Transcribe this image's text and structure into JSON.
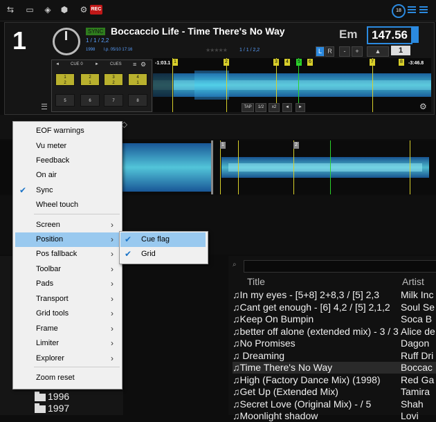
{
  "toolbar": {
    "icons": [
      "mixer-icon",
      "window-icon",
      "broadcast-icon",
      "cube-icon",
      "gear-icon"
    ],
    "rec_label": "REC",
    "clock_label": "18"
  },
  "deck": {
    "number": "1",
    "sync_label": "SYNC",
    "title": "Boccaccio Life - Time There's No Way",
    "subtitle": "1 / 1 / 2,2",
    "year": "1998",
    "last_played": "l.p. 05/10 17:16",
    "rating_count": "1 / 1 / 2,2",
    "key": "Em",
    "bpm": "147.56",
    "pitch_value": "1",
    "lr_left": "L",
    "lr_right": "R",
    "minus": "-",
    "plus": "+",
    "up_arrow": "▲"
  },
  "pads": {
    "cue_label": "CUE 0",
    "cues_label": "CUES",
    "prev": "◄",
    "next": "►",
    "row1": [
      "1\n2",
      "2\n1",
      "3\n2",
      "4\n1"
    ],
    "row2": [
      "5",
      "6",
      "7",
      "8"
    ]
  },
  "overview": {
    "time_left": "-1:03.1",
    "time_right": "-3:46.8",
    "markers": [
      "1",
      "2",
      "3",
      "4",
      "5",
      "6",
      "7",
      "8"
    ],
    "buttons": [
      "TAP",
      "1/2",
      "x2",
      "◄",
      "►"
    ]
  },
  "bigwave": {
    "markers": [
      "1",
      "2"
    ]
  },
  "menu": {
    "items": [
      {
        "label": "EOF warnings",
        "checked": false,
        "submenu": false
      },
      {
        "label": "Vu meter",
        "checked": false,
        "submenu": false
      },
      {
        "label": "Feedback",
        "checked": false,
        "submenu": false
      },
      {
        "label": "On air",
        "checked": false,
        "submenu": false
      },
      {
        "label": "Sync",
        "checked": true,
        "submenu": false
      },
      {
        "label": "Wheel touch",
        "checked": false,
        "submenu": false
      },
      {
        "label": "Screen",
        "checked": false,
        "submenu": true
      },
      {
        "label": "Position",
        "checked": false,
        "submenu": true
      },
      {
        "label": "Pos fallback",
        "checked": false,
        "submenu": true
      },
      {
        "label": "Toolbar",
        "checked": false,
        "submenu": true
      },
      {
        "label": "Pads",
        "checked": false,
        "submenu": true
      },
      {
        "label": "Transport",
        "checked": false,
        "submenu": true
      },
      {
        "label": "Grid tools",
        "checked": false,
        "submenu": true
      },
      {
        "label": "Frame",
        "checked": false,
        "submenu": true
      },
      {
        "label": "Limiter",
        "checked": false,
        "submenu": true
      },
      {
        "label": "Explorer",
        "checked": false,
        "submenu": true
      },
      {
        "label": "Zoom reset",
        "checked": false,
        "submenu": false
      }
    ]
  },
  "submenu": {
    "items": [
      {
        "label": "Cue flag",
        "checked": true
      },
      {
        "label": "Grid",
        "checked": true
      }
    ]
  },
  "folders": [
    "1996",
    "1997"
  ],
  "browser": {
    "col_title": "Title",
    "col_artist": "Artist",
    "rows": [
      {
        "title": "In my eyes - [5+8] 2+8,3 / [5] 2,3",
        "artist": "Milk Inc"
      },
      {
        "title": "Cant get enough - [6] 4,2 / [5] 2,1,2",
        "artist": "Soul Se"
      },
      {
        "title": "Keep On Bumpin",
        "artist": "Soca B"
      },
      {
        "title": "better off alone (extended mix) - 3 / 3",
        "artist": "Alice de"
      },
      {
        "title": "No Promises",
        "artist": "Dagon"
      },
      {
        "title": " Dreaming",
        "artist": "Ruff Dri"
      },
      {
        "title": "Time There's No Way",
        "artist": "Boccac"
      },
      {
        "title": "High (Factory Dance Mix) (1998)",
        "artist": "Red Ga"
      },
      {
        "title": "Get Up (Extended Mix)",
        "artist": "Tamira"
      },
      {
        "title": "Secret Love (Original Mix) - / 5",
        "artist": "Shah"
      },
      {
        "title": "Moonlight shadow",
        "artist": "Lovi"
      }
    ]
  },
  "colors": {
    "accent": "#2b8ae0",
    "menu_highlight": "#99c9ef",
    "cue_marker": "#d8cf2a",
    "waveform": "#2d8ed8"
  }
}
